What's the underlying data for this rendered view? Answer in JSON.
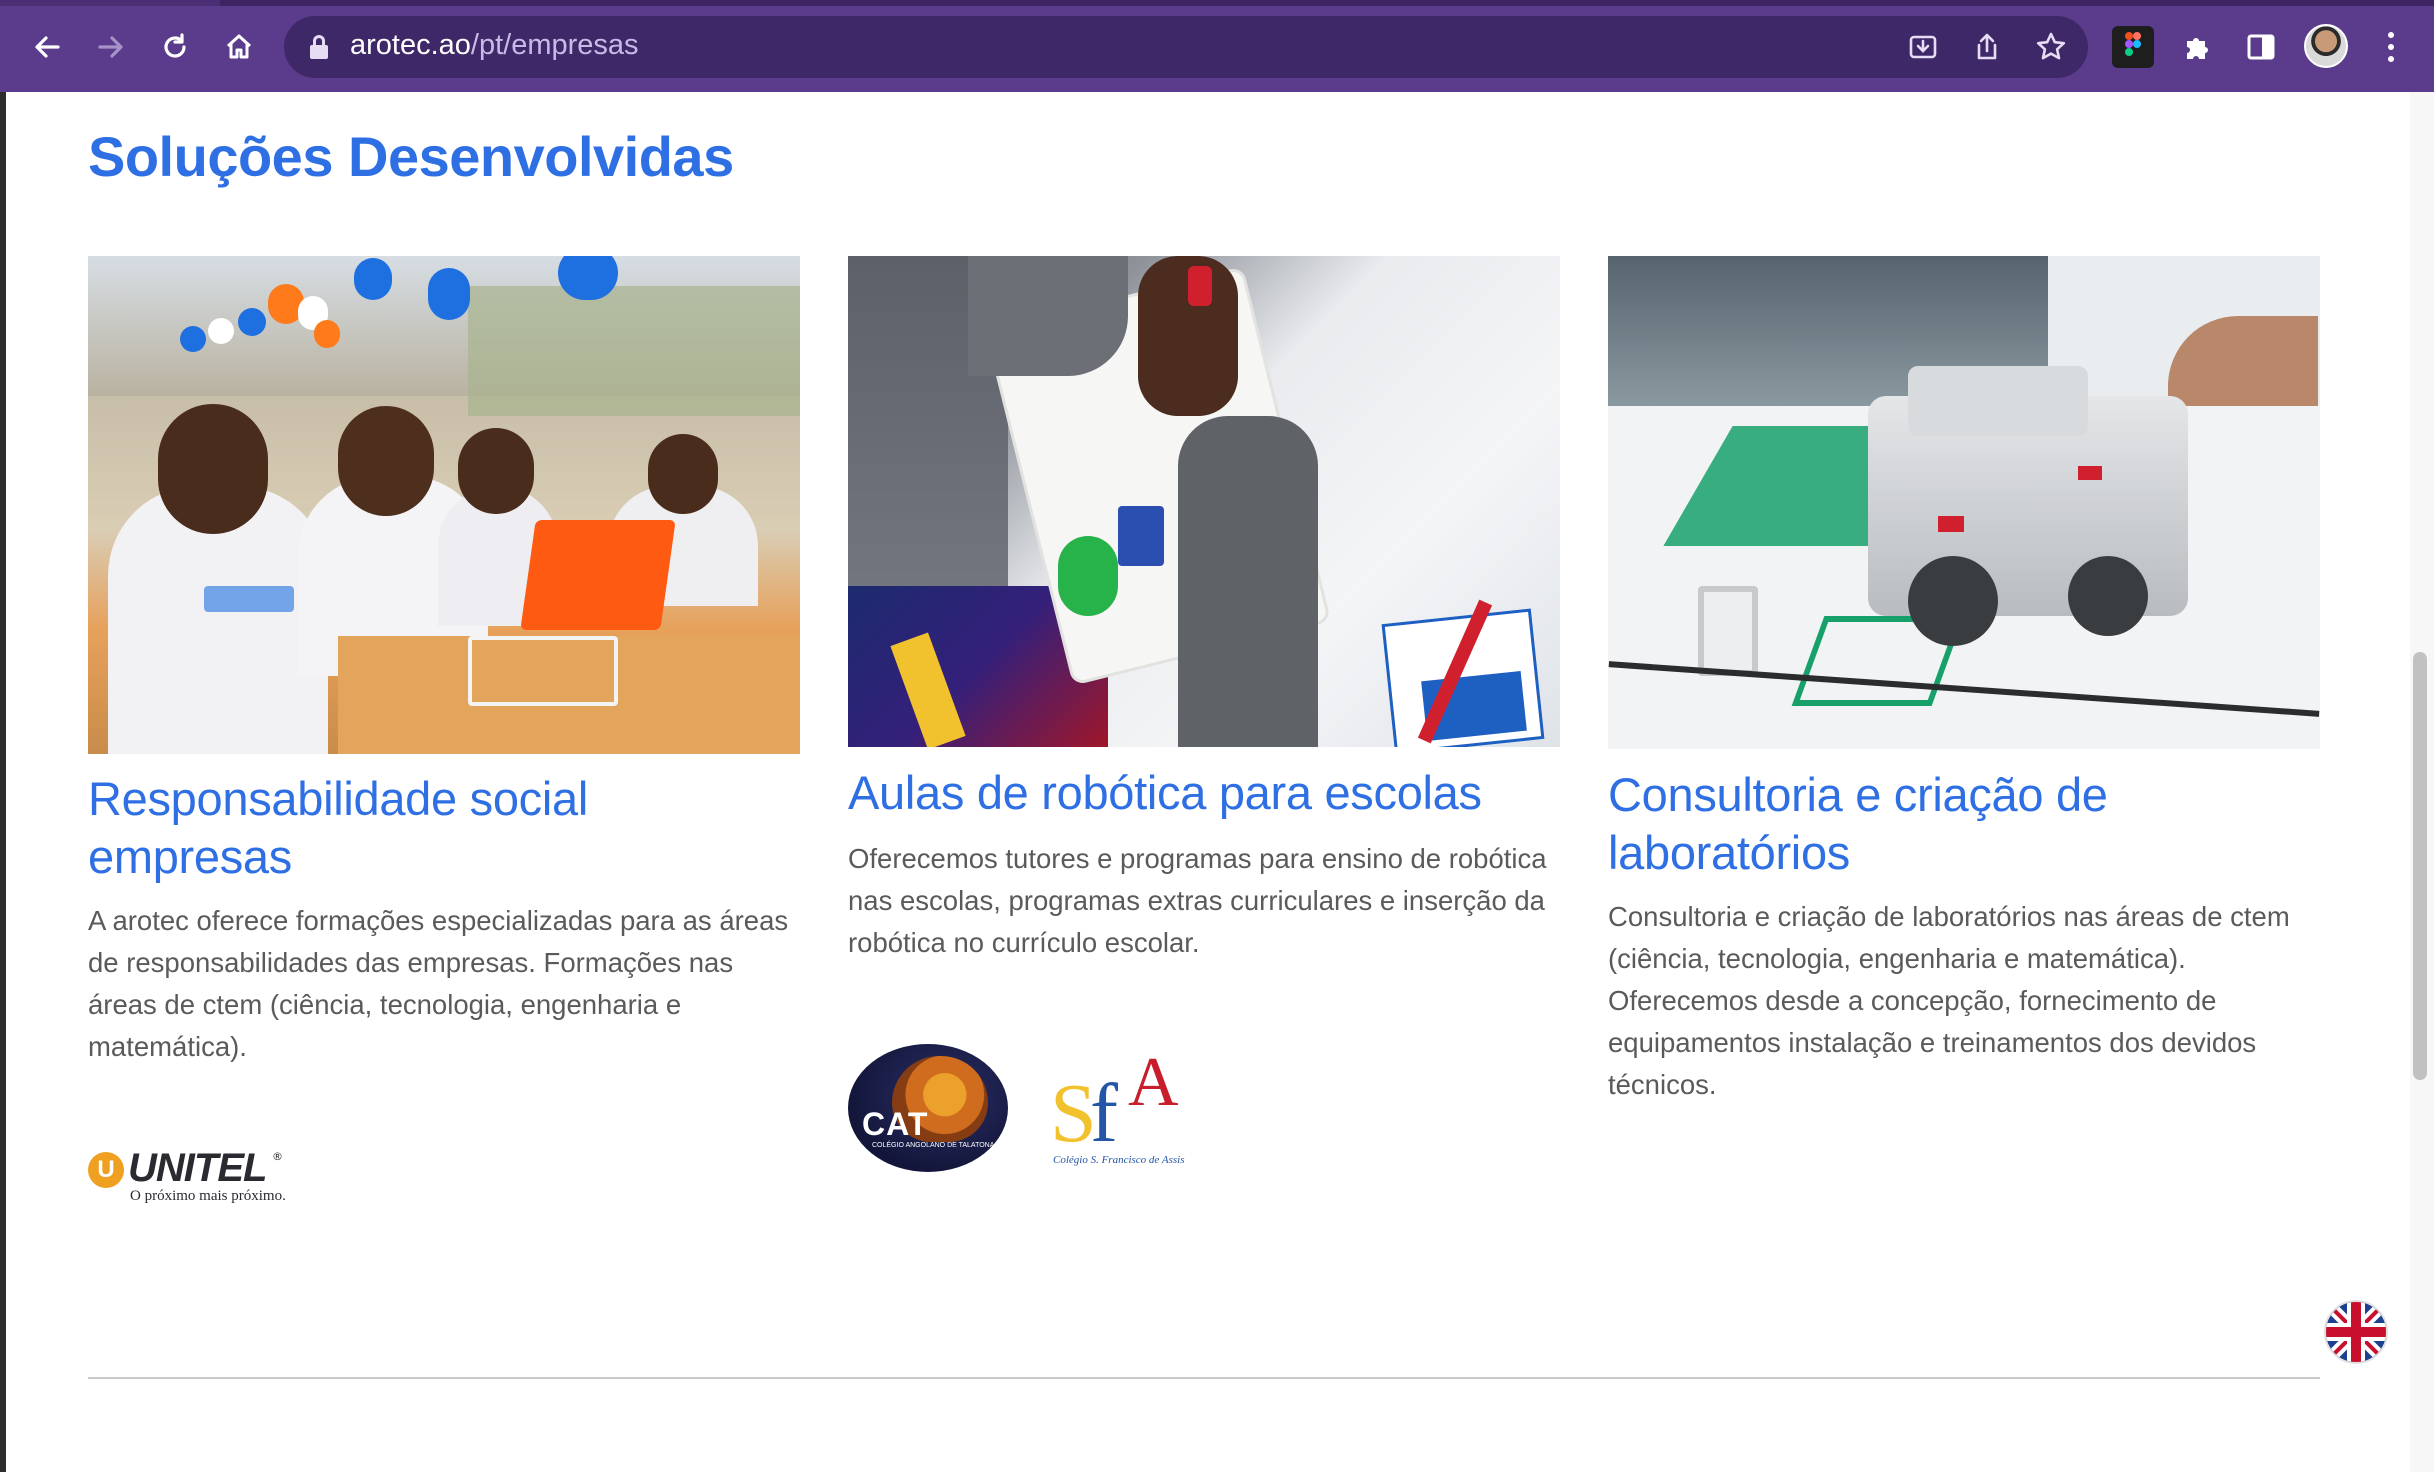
{
  "browser": {
    "url_host": "arotec.ao",
    "url_path": "/pt/empresas",
    "back_icon": "arrow-left-icon",
    "forward_icon": "arrow-right-icon",
    "reload_icon": "reload-icon",
    "home_icon": "home-icon",
    "install_icon": "install-app-icon",
    "share_icon": "share-icon",
    "bookmark_icon": "star-icon",
    "theme_color": "#5a3b8c"
  },
  "section": {
    "title": "Soluções Desenvolvidas",
    "accent_color": "#2f6fe4"
  },
  "cards": [
    {
      "title_line1": "Responsabilidade social",
      "title_line2": "empresas",
      "text_lines": [
        "A arotec oferece formações especializadas para as áreas",
        "de responsabilidades das empresas. Formações nas",
        "áreas de ctem (ciência, tecnologia, engenharia e",
        "matemática)."
      ],
      "image": "students-with-laptops-photo"
    },
    {
      "title_line1": "Aulas de robótica para escolas",
      "text_lines": [
        "Oferecemos tutores e programas para ensino de robótica",
        "nas escolas, programas extras curriculares e inserção da",
        "robótica no currículo escolar."
      ],
      "image": "hands-building-robot-photo"
    },
    {
      "title_line1": "Consultoria e criação de",
      "title_line2": "laboratórios",
      "text_lines": [
        "Consultoria e criação de laboratórios nas áreas de ctem",
        "(ciência, tecnologia, engenharia e matemática).",
        "Oferecemos desde a concepção, fornecimento de",
        "equipamentos instalação e treinamentos dos devidos",
        "técnicos."
      ],
      "image": "lego-robot-photo"
    }
  ],
  "logos": {
    "unitel": {
      "word": "UNITEL",
      "mark": "U",
      "slogan": "O próximo mais próximo."
    },
    "cat": {
      "word": "CAT",
      "subtitle": "COLÉGIO ANGOLANO DE TALATONA"
    },
    "sfa": {
      "s": "S",
      "f": "f",
      "a": "A",
      "subtitle": "Colégio S. Francisco de Assis"
    }
  },
  "language_flag": "uk-flag-icon"
}
